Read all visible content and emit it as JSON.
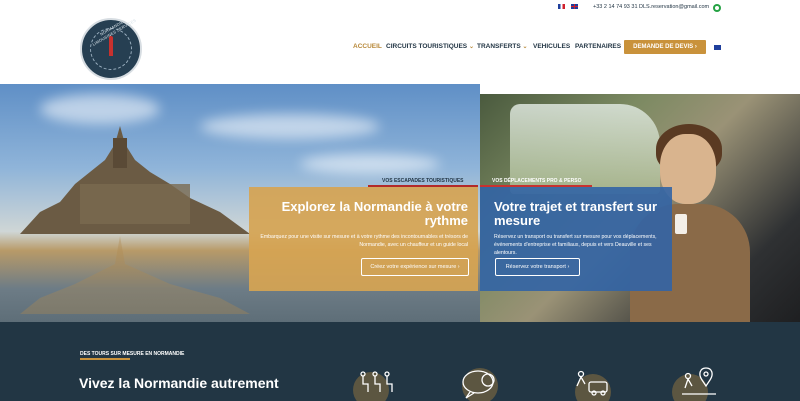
{
  "header": {
    "phone": "+33 2 14 74 93 31",
    "email": "DLS.reservation@gmail.com",
    "logo_text": "NORMANDIE LIMOUSINES SERVICES"
  },
  "nav": {
    "items": [
      "ACCUEIL",
      "CIRCUITS TOURISTIQUES",
      "TRANSFERTS",
      "VEHICULES",
      "PARTENAIRES"
    ],
    "cta": "DEMANDE DE DEVIS ›"
  },
  "hero": {
    "left": {
      "tag": "VOS ESCAPADES TOURISTIQUES",
      "title": "Explorez la Normandie à votre rythme",
      "text": "Embarquez pour une visite sur mesure et à votre rythme des incontournables et trésors de Normandie, avec un chauffeur et un guide local",
      "button": "Créez votre expérience sur mesure   ›"
    },
    "right": {
      "tag": "VOS DÉPLACEMENTS PRO & PERSO",
      "title": "Votre trajet et transfert sur mesure",
      "text": "Réservez un transport ou transfert sur mesure pour vos déplacements, événements d'entreprise et familiaux, depuis et vers Deauville et ses alentours.",
      "button": "Réservez votre transport   ›"
    }
  },
  "bottom": {
    "tag": "DES TOURS SUR MESURE EN NORMANDIE",
    "title": "Vivez la Normandie autrement"
  },
  "colors": {
    "accent": "#c9923b",
    "navy": "#223644",
    "red": "#c8322f"
  }
}
